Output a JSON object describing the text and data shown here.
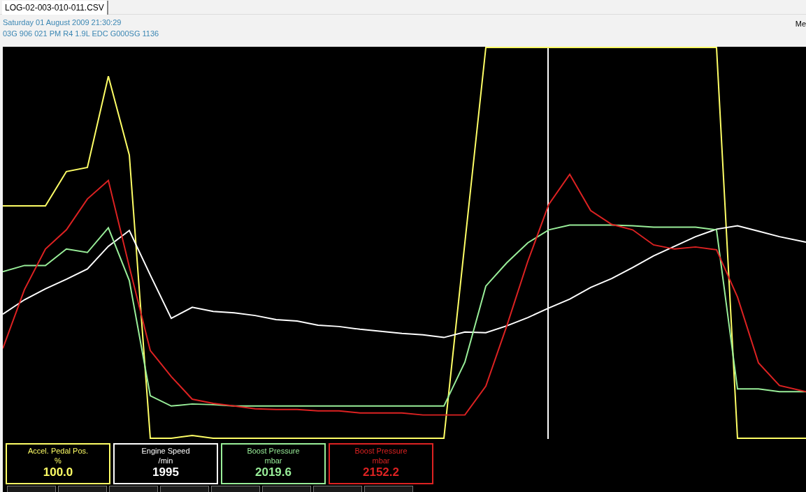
{
  "tabs": [
    {
      "label": "LOG-02-003-010-011.CSV",
      "selected": true
    }
  ],
  "header": {
    "date": "Saturday 01 August 2009 21:30:29",
    "ecu": "03G 906 021 PM  R4 1.9L EDC G000SG  1136",
    "right_label": "Me"
  },
  "gauges": [
    {
      "label": "Accel. Pedal Pos.",
      "unit": "%",
      "value": "100.0",
      "color": "#ffff66"
    },
    {
      "label": "Engine Speed",
      "unit": "/min",
      "value": "1995",
      "color": "#ffffff"
    },
    {
      "label": "Boost Pressure",
      "unit": "mbar",
      "value": "2019.6",
      "color": "#99ee99"
    },
    {
      "label": "Boost Pressure",
      "unit": "mbar",
      "value": "2152.2",
      "color": "#dd2222"
    }
  ]
}
